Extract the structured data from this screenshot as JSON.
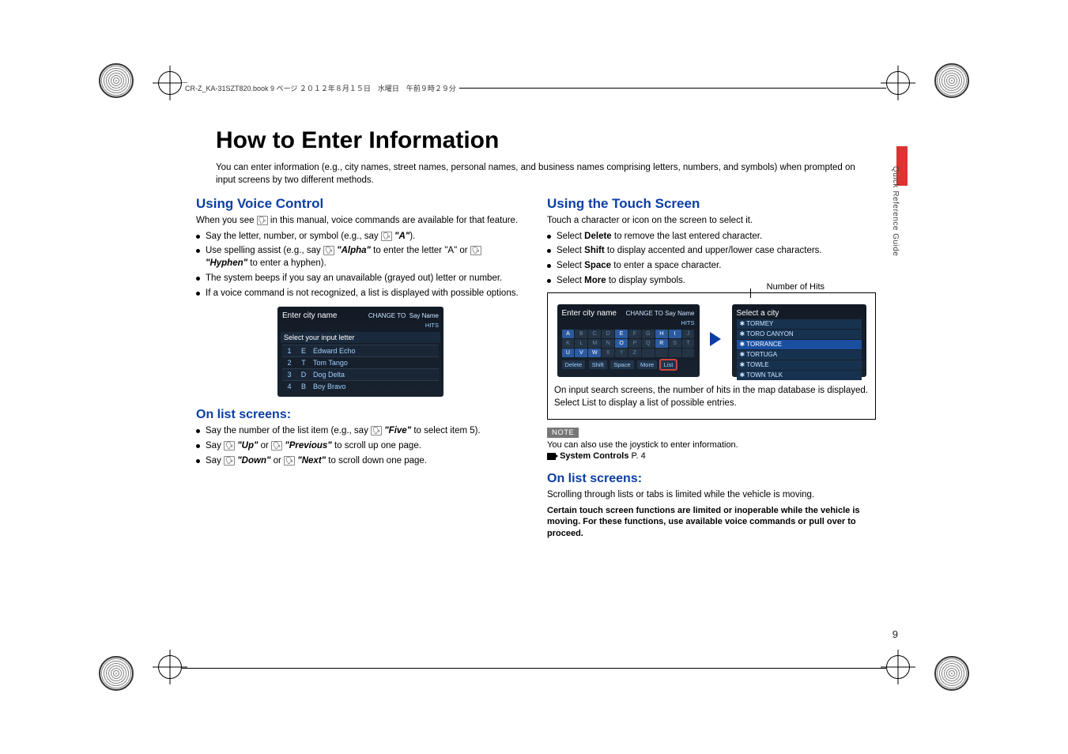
{
  "header_strip": "CR-Z_KA-31SZT820.book  9 ページ  ２０１２年８月１５日　水曜日　午前９時２９分",
  "side_label": "Quick Reference Guide",
  "page_number": "9",
  "title": "How to Enter Information",
  "intro": "You can enter information (e.g., city names, street names, personal names, and business names comprising letters, numbers, and symbols) when prompted on input screens by two different methods.",
  "left": {
    "h_voice": "Using Voice Control",
    "voice_para_a": "When you see ",
    "voice_para_b": " in this manual, voice commands are available for that feature.",
    "b1_a": "Say the letter, number, or symbol (e.g., say ",
    "b1_q": "\"A\"",
    "b1_b": ").",
    "b2_a": "Use spelling assist (e.g., say ",
    "b2_q1": "\"Alpha\"",
    "b2_mid": " to enter the letter \"A\" or ",
    "b2_q2": "\"Hyphen\"",
    "b2_b": " to enter a hyphen).",
    "b3": "The system beeps if you say an unavailable (grayed out) letter or number.",
    "b4": "If a voice command is not recognized, a list is displayed with possible options.",
    "shot_title": "Enter city name",
    "shot_change": "CHANGE TO",
    "shot_say": "Say Name",
    "shot_hits": "HITS",
    "shot_prompt": "Select your input letter",
    "shot_rows": [
      {
        "n": "1",
        "k": "E",
        "w": "Edward Echo"
      },
      {
        "n": "2",
        "k": "T",
        "w": "Tom Tango"
      },
      {
        "n": "3",
        "k": "D",
        "w": "Dog Delta"
      },
      {
        "n": "4",
        "k": "B",
        "w": "Boy Bravo"
      }
    ],
    "h_list": "On list screens:",
    "l1_a": "Say the number of the list item (e.g., say ",
    "l1_q": "\"Five\"",
    "l1_b": " to select item 5).",
    "l2_a": "Say ",
    "l2_q1": "\"Up\"",
    "l2_mid": " or ",
    "l2_q2": "\"Previous\"",
    "l2_b": " to scroll up one page.",
    "l3_a": "Say ",
    "l3_q1": "\"Down\"",
    "l3_mid": " or ",
    "l3_q2": "\"Next\"",
    "l3_b": " to scroll down one page."
  },
  "right": {
    "h_touch": "Using the Touch Screen",
    "touch_para": "Touch a character or icon on the screen to select it.",
    "tb1_a": "Select ",
    "tb1_s": "Delete",
    "tb1_b": " to remove the last entered character.",
    "tb2_a": "Select ",
    "tb2_s": "Shift",
    "tb2_b": " to display accented and upper/lower case characters.",
    "tb3_a": "Select ",
    "tb3_s": "Space",
    "tb3_b": " to enter a space character.",
    "tb4_a": "Select ",
    "tb4_s": "More",
    "tb4_b": " to display symbols.",
    "cap_label": "Number of Hits",
    "shot2": {
      "title": "Enter city name",
      "change": "CHANGE TO",
      "say": "Say Name",
      "hits": "HITS",
      "keys": [
        "A",
        "B",
        "C",
        "D",
        "E",
        "F",
        "G",
        "H",
        "I",
        "J",
        "K",
        "L",
        "M",
        "N",
        "O",
        "P",
        "Q",
        "R",
        "S",
        "T",
        "U",
        "V",
        "W",
        "X",
        "Y",
        "Z",
        "",
        "",
        "",
        ""
      ],
      "on": [
        "A",
        "E",
        "H",
        "I",
        "O",
        "R",
        "U",
        "V",
        "W"
      ],
      "delete": "Delete",
      "shift": "Shift",
      "space": "Space",
      "more": "More",
      "list": "List"
    },
    "shot3": {
      "title": "Select a city",
      "items": [
        "TORMEY",
        "TORO CANYON",
        "TORRANCE",
        "TORTUGA",
        "TOWLE",
        "TOWN TALK"
      ],
      "sel": "TORRANCE"
    },
    "cap_text_a": "On input search screens, the number of hits in the map database is displayed. Select ",
    "cap_text_s": "List",
    "cap_text_b": " to display a list of possible entries.",
    "note_tag": "NOTE",
    "note_line": "You can also use the joystick to enter information.",
    "note_link": "System Controls",
    "note_pg": " P. 4",
    "h_list": "On list screens:",
    "list_para": "Scrolling through lists or tabs is limited while the vehicle is moving.",
    "warn": "Certain touch screen functions are limited or inoperable while the vehicle is moving. For these functions, use available voice commands or pull over to proceed."
  }
}
